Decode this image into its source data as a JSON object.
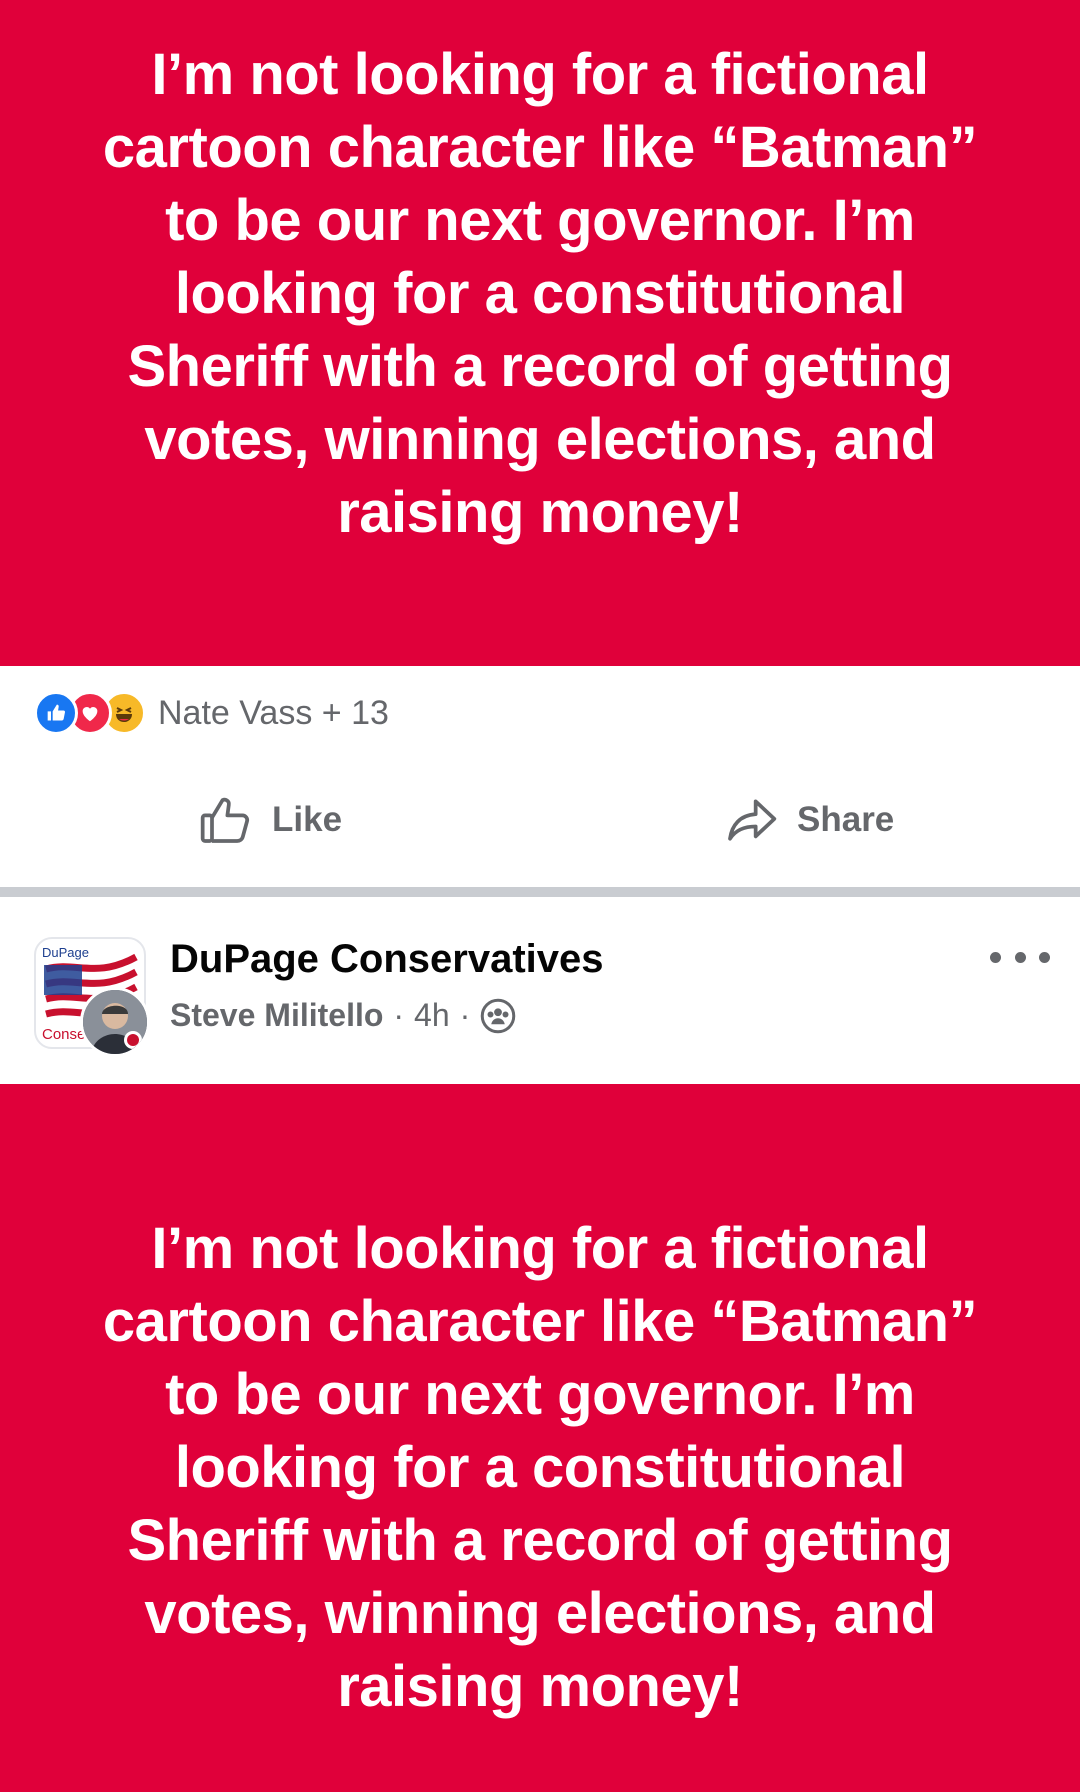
{
  "post1": {
    "text": "I’m not looking for a fictional\ncartoon character like “Batman”\nto be our next governor.  I’m\nlooking for a constitutional\nSheriff with a record of getting\nvotes, winning elections, and\nraising money!"
  },
  "reactions": {
    "icons": [
      "like-icon",
      "love-icon",
      "haha-icon"
    ],
    "summary": "Nate Vass + 13"
  },
  "actions": {
    "like_label": "Like",
    "share_label": "Share"
  },
  "post2": {
    "group_name": "DuPage Conservatives",
    "author": "Steve Militello",
    "separator": "·",
    "time": "4h",
    "privacy_icon": "group-members-icon",
    "avatar_text_top": "DuPage",
    "avatar_text_bottom": "Conse",
    "text": "I’m not looking for a fictional\ncartoon character like “Batman”\nto be our next governor.  I’m\nlooking for a constitutional\nSheriff with a record of getting\nvotes, winning elections, and\nraising money!"
  },
  "colors": {
    "post_background": "#e0003a",
    "text_secondary": "#65676b",
    "like_blue": "#1877f2"
  }
}
